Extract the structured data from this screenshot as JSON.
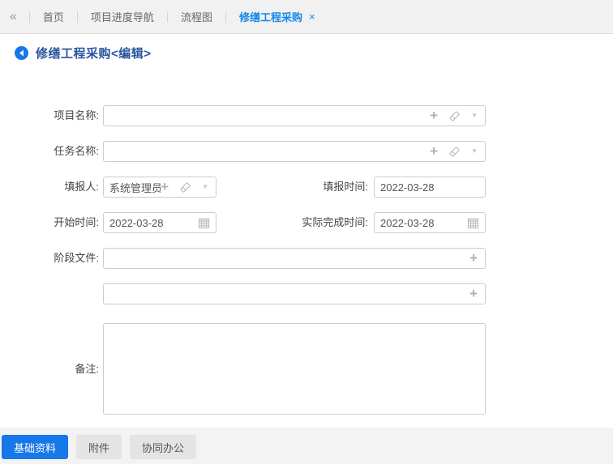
{
  "colors": {
    "accent_tab_blue": "#1688ea",
    "button_blue": "#1678e8",
    "title_blue": "#27549f",
    "topbar_bg": "#f1f1f1",
    "bottombar_bg": "#f3f3f3",
    "input_border": "#cccccc",
    "icon_gray": "#b3b3b3"
  },
  "topbar": {
    "collapse_icon": "«",
    "tabs": [
      {
        "label": "首页"
      },
      {
        "label": "项目进度导航"
      },
      {
        "label": "流程图"
      },
      {
        "label": "修缮工程采购",
        "active": true,
        "close_icon": "×"
      }
    ]
  },
  "page": {
    "title": "修缮工程采购<编辑>"
  },
  "form": {
    "project_name": {
      "label": "项目名称:",
      "value": ""
    },
    "task_name": {
      "label": "任务名称:",
      "value": ""
    },
    "filler": {
      "label": "填报人:",
      "value": "系统管理员"
    },
    "fill_time": {
      "label": "填报时间:",
      "value": "2022-03-28"
    },
    "start_time": {
      "label": "开始时间:",
      "value": "2022-03-28"
    },
    "actual_finish": {
      "label": "实际完成时间:",
      "value": "2022-03-28"
    },
    "stage_file": {
      "label": "阶段文件:",
      "value": ""
    },
    "stage_file_2": {
      "value": ""
    },
    "remark": {
      "label": "备注:",
      "value": ""
    }
  },
  "icons": {
    "plus": "+",
    "caret": "▼"
  },
  "bottombar": {
    "tabs": [
      {
        "label": "基础资料",
        "active": true
      },
      {
        "label": "附件"
      },
      {
        "label": "协同办公"
      }
    ]
  }
}
